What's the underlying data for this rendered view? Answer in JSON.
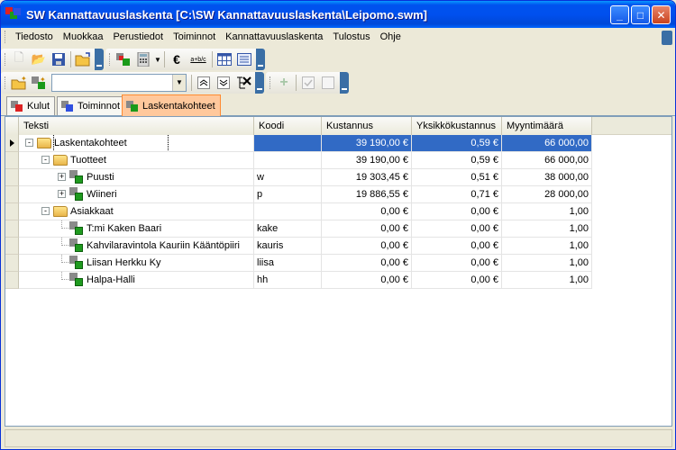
{
  "window": {
    "title": "SW Kannattavuuslaskenta [C:\\SW Kannattavuuslaskenta\\Leipomo.swm]"
  },
  "menu": [
    "Tiedosto",
    "Muokkaa",
    "Perustiedot",
    "Toiminnot",
    "Kannattavuuslaskenta",
    "Tulostus",
    "Ohje"
  ],
  "toolbar": {
    "euro_symbol": "€",
    "abc_symbol": "a+b/c",
    "combo_value": ""
  },
  "tabs": [
    "Kulut",
    "Toiminnot",
    "Laskentakohteet"
  ],
  "grid": {
    "columns": [
      "Teksti",
      "Koodi",
      "Kustannus",
      "Yksikkökustannus",
      "Myyntimäärä"
    ],
    "rows": [
      {
        "text": "Laskentakohteet",
        "code": "",
        "cost": "39 190,00 €",
        "unit": "0,59 €",
        "qty": "66 000,00"
      },
      {
        "text": "Tuotteet",
        "code": "",
        "cost": "39 190,00 €",
        "unit": "0,59 €",
        "qty": "66 000,00"
      },
      {
        "text": "Puusti",
        "code": "w",
        "cost": "19 303,45 €",
        "unit": "0,51 €",
        "qty": "38 000,00"
      },
      {
        "text": "Wiineri",
        "code": "p",
        "cost": "19 886,55 €",
        "unit": "0,71 €",
        "qty": "28 000,00"
      },
      {
        "text": "Asiakkaat",
        "code": "",
        "cost": "0,00 €",
        "unit": "0,00 €",
        "qty": "1,00"
      },
      {
        "text": "T:mi Kaken Baari",
        "code": "kake",
        "cost": "0,00 €",
        "unit": "0,00 €",
        "qty": "1,00"
      },
      {
        "text": "Kahvilaravintola Kauriin Kääntöpiiri",
        "code": "kauris",
        "cost": "0,00 €",
        "unit": "0,00 €",
        "qty": "1,00"
      },
      {
        "text": "Liisan Herkku Ky",
        "code": "liisa",
        "cost": "0,00 €",
        "unit": "0,00 €",
        "qty": "1,00"
      },
      {
        "text": "Halpa-Halli",
        "code": "hh",
        "cost": "0,00 €",
        "unit": "0,00 €",
        "qty": "1,00"
      }
    ]
  },
  "colors": {
    "selection": "#316ac5",
    "titlebar": "#0054e3",
    "active_tab": "#ffc89c"
  }
}
